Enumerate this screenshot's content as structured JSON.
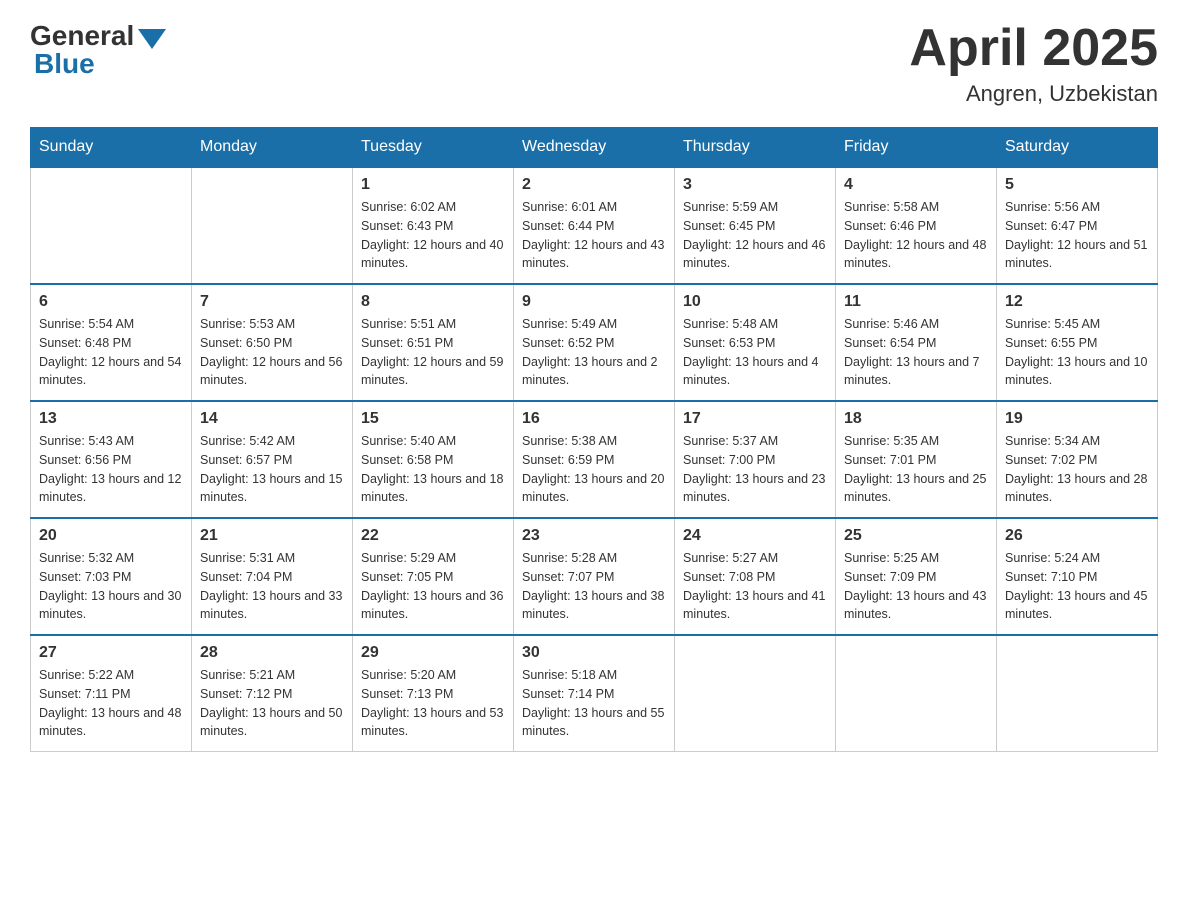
{
  "header": {
    "logo_general": "General",
    "logo_blue": "Blue",
    "title": "April 2025",
    "location": "Angren, Uzbekistan"
  },
  "weekdays": [
    "Sunday",
    "Monday",
    "Tuesday",
    "Wednesday",
    "Thursday",
    "Friday",
    "Saturday"
  ],
  "weeks": [
    [
      {
        "day": "",
        "sunrise": "",
        "sunset": "",
        "daylight": ""
      },
      {
        "day": "",
        "sunrise": "",
        "sunset": "",
        "daylight": ""
      },
      {
        "day": "1",
        "sunrise": "Sunrise: 6:02 AM",
        "sunset": "Sunset: 6:43 PM",
        "daylight": "Daylight: 12 hours and 40 minutes."
      },
      {
        "day": "2",
        "sunrise": "Sunrise: 6:01 AM",
        "sunset": "Sunset: 6:44 PM",
        "daylight": "Daylight: 12 hours and 43 minutes."
      },
      {
        "day": "3",
        "sunrise": "Sunrise: 5:59 AM",
        "sunset": "Sunset: 6:45 PM",
        "daylight": "Daylight: 12 hours and 46 minutes."
      },
      {
        "day": "4",
        "sunrise": "Sunrise: 5:58 AM",
        "sunset": "Sunset: 6:46 PM",
        "daylight": "Daylight: 12 hours and 48 minutes."
      },
      {
        "day": "5",
        "sunrise": "Sunrise: 5:56 AM",
        "sunset": "Sunset: 6:47 PM",
        "daylight": "Daylight: 12 hours and 51 minutes."
      }
    ],
    [
      {
        "day": "6",
        "sunrise": "Sunrise: 5:54 AM",
        "sunset": "Sunset: 6:48 PM",
        "daylight": "Daylight: 12 hours and 54 minutes."
      },
      {
        "day": "7",
        "sunrise": "Sunrise: 5:53 AM",
        "sunset": "Sunset: 6:50 PM",
        "daylight": "Daylight: 12 hours and 56 minutes."
      },
      {
        "day": "8",
        "sunrise": "Sunrise: 5:51 AM",
        "sunset": "Sunset: 6:51 PM",
        "daylight": "Daylight: 12 hours and 59 minutes."
      },
      {
        "day": "9",
        "sunrise": "Sunrise: 5:49 AM",
        "sunset": "Sunset: 6:52 PM",
        "daylight": "Daylight: 13 hours and 2 minutes."
      },
      {
        "day": "10",
        "sunrise": "Sunrise: 5:48 AM",
        "sunset": "Sunset: 6:53 PM",
        "daylight": "Daylight: 13 hours and 4 minutes."
      },
      {
        "day": "11",
        "sunrise": "Sunrise: 5:46 AM",
        "sunset": "Sunset: 6:54 PM",
        "daylight": "Daylight: 13 hours and 7 minutes."
      },
      {
        "day": "12",
        "sunrise": "Sunrise: 5:45 AM",
        "sunset": "Sunset: 6:55 PM",
        "daylight": "Daylight: 13 hours and 10 minutes."
      }
    ],
    [
      {
        "day": "13",
        "sunrise": "Sunrise: 5:43 AM",
        "sunset": "Sunset: 6:56 PM",
        "daylight": "Daylight: 13 hours and 12 minutes."
      },
      {
        "day": "14",
        "sunrise": "Sunrise: 5:42 AM",
        "sunset": "Sunset: 6:57 PM",
        "daylight": "Daylight: 13 hours and 15 minutes."
      },
      {
        "day": "15",
        "sunrise": "Sunrise: 5:40 AM",
        "sunset": "Sunset: 6:58 PM",
        "daylight": "Daylight: 13 hours and 18 minutes."
      },
      {
        "day": "16",
        "sunrise": "Sunrise: 5:38 AM",
        "sunset": "Sunset: 6:59 PM",
        "daylight": "Daylight: 13 hours and 20 minutes."
      },
      {
        "day": "17",
        "sunrise": "Sunrise: 5:37 AM",
        "sunset": "Sunset: 7:00 PM",
        "daylight": "Daylight: 13 hours and 23 minutes."
      },
      {
        "day": "18",
        "sunrise": "Sunrise: 5:35 AM",
        "sunset": "Sunset: 7:01 PM",
        "daylight": "Daylight: 13 hours and 25 minutes."
      },
      {
        "day": "19",
        "sunrise": "Sunrise: 5:34 AM",
        "sunset": "Sunset: 7:02 PM",
        "daylight": "Daylight: 13 hours and 28 minutes."
      }
    ],
    [
      {
        "day": "20",
        "sunrise": "Sunrise: 5:32 AM",
        "sunset": "Sunset: 7:03 PM",
        "daylight": "Daylight: 13 hours and 30 minutes."
      },
      {
        "day": "21",
        "sunrise": "Sunrise: 5:31 AM",
        "sunset": "Sunset: 7:04 PM",
        "daylight": "Daylight: 13 hours and 33 minutes."
      },
      {
        "day": "22",
        "sunrise": "Sunrise: 5:29 AM",
        "sunset": "Sunset: 7:05 PM",
        "daylight": "Daylight: 13 hours and 36 minutes."
      },
      {
        "day": "23",
        "sunrise": "Sunrise: 5:28 AM",
        "sunset": "Sunset: 7:07 PM",
        "daylight": "Daylight: 13 hours and 38 minutes."
      },
      {
        "day": "24",
        "sunrise": "Sunrise: 5:27 AM",
        "sunset": "Sunset: 7:08 PM",
        "daylight": "Daylight: 13 hours and 41 minutes."
      },
      {
        "day": "25",
        "sunrise": "Sunrise: 5:25 AM",
        "sunset": "Sunset: 7:09 PM",
        "daylight": "Daylight: 13 hours and 43 minutes."
      },
      {
        "day": "26",
        "sunrise": "Sunrise: 5:24 AM",
        "sunset": "Sunset: 7:10 PM",
        "daylight": "Daylight: 13 hours and 45 minutes."
      }
    ],
    [
      {
        "day": "27",
        "sunrise": "Sunrise: 5:22 AM",
        "sunset": "Sunset: 7:11 PM",
        "daylight": "Daylight: 13 hours and 48 minutes."
      },
      {
        "day": "28",
        "sunrise": "Sunrise: 5:21 AM",
        "sunset": "Sunset: 7:12 PM",
        "daylight": "Daylight: 13 hours and 50 minutes."
      },
      {
        "day": "29",
        "sunrise": "Sunrise: 5:20 AM",
        "sunset": "Sunset: 7:13 PM",
        "daylight": "Daylight: 13 hours and 53 minutes."
      },
      {
        "day": "30",
        "sunrise": "Sunrise: 5:18 AM",
        "sunset": "Sunset: 7:14 PM",
        "daylight": "Daylight: 13 hours and 55 minutes."
      },
      {
        "day": "",
        "sunrise": "",
        "sunset": "",
        "daylight": ""
      },
      {
        "day": "",
        "sunrise": "",
        "sunset": "",
        "daylight": ""
      },
      {
        "day": "",
        "sunrise": "",
        "sunset": "",
        "daylight": ""
      }
    ]
  ]
}
